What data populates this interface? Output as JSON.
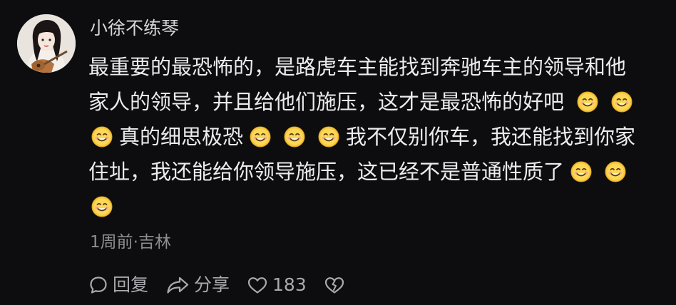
{
  "comment": {
    "username": "小徐不练琴",
    "lines": [
      [
        "最重要的最恐怖的，是路虎车主能找到奔驰车主的领导和他"
      ],
      [
        "家人的领导，并且给他们施压，这才是最恐怖的好吧"
      ],
      [
        "真的细思极恐"
      ],
      [
        "我不仅别你车，我还能找到你家"
      ],
      [
        "住址，我还能给你领导施压，这已经不是普通性质了"
      ]
    ],
    "emoji": "smile-emoji",
    "meta": "1周前·吉林",
    "actions": {
      "reply_label": "回复",
      "share_label": "分享",
      "like_count": "183"
    }
  }
}
